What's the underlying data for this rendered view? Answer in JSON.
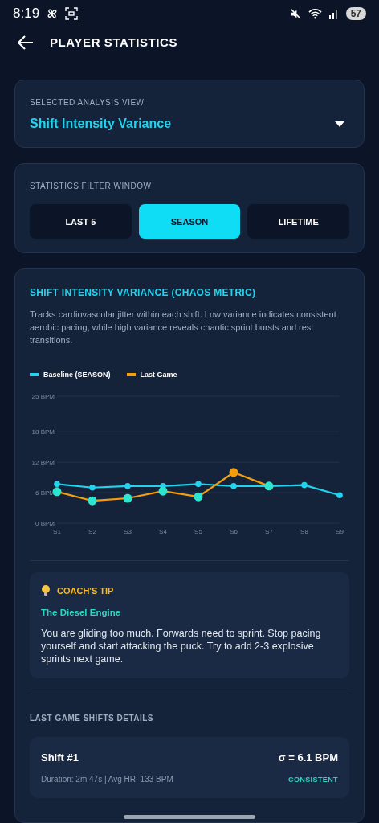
{
  "status_bar": {
    "time": "8:19",
    "battery": "57"
  },
  "header": {
    "title": "PLAYER STATISTICS"
  },
  "analysis_view": {
    "label": "SELECTED ANALYSIS VIEW",
    "value": "Shift Intensity Variance"
  },
  "filter": {
    "label": "STATISTICS FILTER WINDOW",
    "options": [
      {
        "label": "LAST 5",
        "selected": false
      },
      {
        "label": "SEASON",
        "selected": true
      },
      {
        "label": "LIFETIME",
        "selected": false
      }
    ]
  },
  "metric": {
    "title": "SHIFT INTENSITY VARIANCE (CHAOS METRIC)",
    "description": "Tracks cardiovascular jitter within each shift. Low variance indicates consistent aerobic pacing, while high variance reveals chaotic sprint bursts and rest transitions.",
    "chart_data": {
      "type": "line",
      "grid": true,
      "categories": [
        "S1",
        "S2",
        "S3",
        "S4",
        "S5",
        "S6",
        "S7",
        "S8",
        "S9"
      ],
      "ylim": [
        0,
        25
      ],
      "yticks": [
        {
          "value": 0,
          "label": "0 BPM"
        },
        {
          "value": 6,
          "label": "6 BPM"
        },
        {
          "value": 12,
          "label": "12 BPM"
        },
        {
          "value": 18,
          "label": "18 BPM"
        },
        {
          "value": 25,
          "label": "25 BPM"
        }
      ],
      "series": [
        {
          "name": "Baseline (SEASON)",
          "color": "#22d3ee",
          "marker": "circle",
          "values": [
            7.7,
            7.0,
            7.3,
            7.3,
            7.7,
            7.3,
            7.3,
            7.5,
            5.5
          ]
        },
        {
          "name": "Last Game",
          "color": "#f59e0b",
          "marker": "circle",
          "values": [
            6.2,
            4.4,
            4.9,
            6.3,
            5.2,
            10.0,
            7.3,
            null,
            null
          ]
        }
      ]
    }
  },
  "tip": {
    "heading": "COACH'S TIP",
    "title": "The Diesel Engine",
    "body": "You are gliding too much. Forwards need to sprint. Stop pacing yourself and start attacking the puck. Try to add 2-3 explosive sprints next game."
  },
  "shifts": {
    "heading": "LAST GAME SHIFTS DETAILS",
    "items": [
      {
        "name": "Shift #1",
        "sigma": "σ = 6.1 BPM",
        "details": "Duration: 2m 47s | Avg HR: 133 BPM",
        "status": "CONSISTENT",
        "color": "#2dd4bf"
      }
    ]
  }
}
